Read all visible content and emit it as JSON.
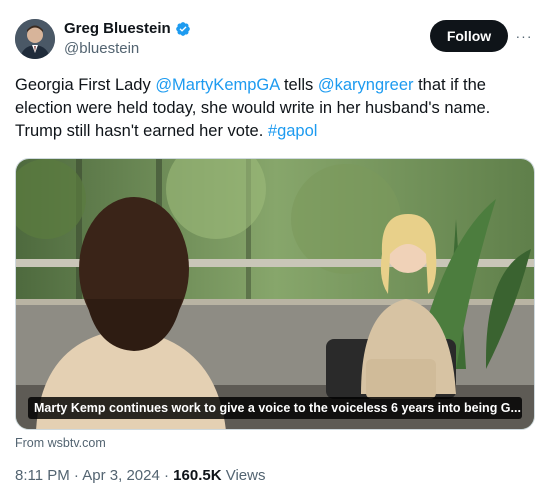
{
  "author": {
    "display_name": "Greg Bluestein",
    "handle": "@bluestein",
    "verified_icon": "verified-badge-icon"
  },
  "actions": {
    "follow_label": "Follow",
    "more_label": "···"
  },
  "tweet": {
    "t1": "Georgia First Lady ",
    "mention1": "@MartyKempGA",
    "t2": " tells ",
    "mention2": "@karyngreer",
    "t3": " that if the election were held today, she would write in her husband's name. Trump still hasn't earned her vote. ",
    "hashtag": "#gapol"
  },
  "media": {
    "caption": "Marty Kemp continues work to give a voice to the voiceless 6 years into being G...",
    "source": "From wsbtv.com"
  },
  "meta": {
    "time": "8:11 PM",
    "sep1": " · ",
    "date": "Apr 3, 2024",
    "sep2": " · ",
    "views_count": "160.5K",
    "views_label": " Views"
  },
  "colors": {
    "link": "#1d9bf0",
    "muted": "#536471",
    "text": "#0f1419",
    "verified": "#1d9bf0"
  }
}
